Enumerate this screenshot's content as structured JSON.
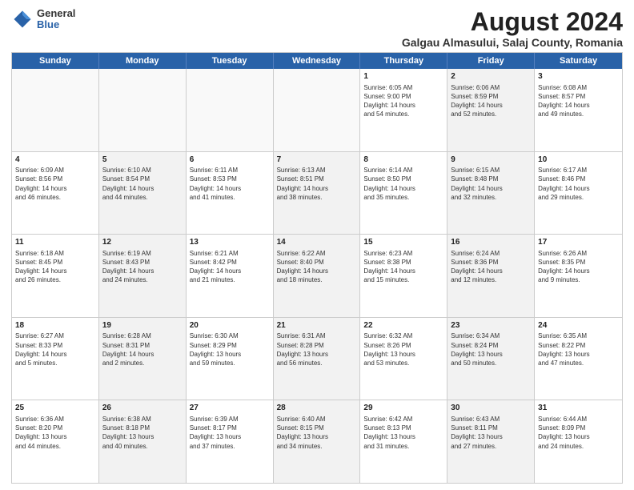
{
  "logo": {
    "general": "General",
    "blue": "Blue"
  },
  "title": "August 2024",
  "subtitle": "Galgau Almasului, Salaj County, Romania",
  "header_days": [
    "Sunday",
    "Monday",
    "Tuesday",
    "Wednesday",
    "Thursday",
    "Friday",
    "Saturday"
  ],
  "rows": [
    [
      {
        "day": "",
        "info": "",
        "shaded": false,
        "empty": true
      },
      {
        "day": "",
        "info": "",
        "shaded": false,
        "empty": true
      },
      {
        "day": "",
        "info": "",
        "shaded": false,
        "empty": true
      },
      {
        "day": "",
        "info": "",
        "shaded": false,
        "empty": true
      },
      {
        "day": "1",
        "info": "Sunrise: 6:05 AM\nSunset: 9:00 PM\nDaylight: 14 hours\nand 54 minutes.",
        "shaded": false,
        "empty": false
      },
      {
        "day": "2",
        "info": "Sunrise: 6:06 AM\nSunset: 8:59 PM\nDaylight: 14 hours\nand 52 minutes.",
        "shaded": true,
        "empty": false
      },
      {
        "day": "3",
        "info": "Sunrise: 6:08 AM\nSunset: 8:57 PM\nDaylight: 14 hours\nand 49 minutes.",
        "shaded": false,
        "empty": false
      }
    ],
    [
      {
        "day": "4",
        "info": "Sunrise: 6:09 AM\nSunset: 8:56 PM\nDaylight: 14 hours\nand 46 minutes.",
        "shaded": false,
        "empty": false
      },
      {
        "day": "5",
        "info": "Sunrise: 6:10 AM\nSunset: 8:54 PM\nDaylight: 14 hours\nand 44 minutes.",
        "shaded": true,
        "empty": false
      },
      {
        "day": "6",
        "info": "Sunrise: 6:11 AM\nSunset: 8:53 PM\nDaylight: 14 hours\nand 41 minutes.",
        "shaded": false,
        "empty": false
      },
      {
        "day": "7",
        "info": "Sunrise: 6:13 AM\nSunset: 8:51 PM\nDaylight: 14 hours\nand 38 minutes.",
        "shaded": true,
        "empty": false
      },
      {
        "day": "8",
        "info": "Sunrise: 6:14 AM\nSunset: 8:50 PM\nDaylight: 14 hours\nand 35 minutes.",
        "shaded": false,
        "empty": false
      },
      {
        "day": "9",
        "info": "Sunrise: 6:15 AM\nSunset: 8:48 PM\nDaylight: 14 hours\nand 32 minutes.",
        "shaded": true,
        "empty": false
      },
      {
        "day": "10",
        "info": "Sunrise: 6:17 AM\nSunset: 8:46 PM\nDaylight: 14 hours\nand 29 minutes.",
        "shaded": false,
        "empty": false
      }
    ],
    [
      {
        "day": "11",
        "info": "Sunrise: 6:18 AM\nSunset: 8:45 PM\nDaylight: 14 hours\nand 26 minutes.",
        "shaded": false,
        "empty": false
      },
      {
        "day": "12",
        "info": "Sunrise: 6:19 AM\nSunset: 8:43 PM\nDaylight: 14 hours\nand 24 minutes.",
        "shaded": true,
        "empty": false
      },
      {
        "day": "13",
        "info": "Sunrise: 6:21 AM\nSunset: 8:42 PM\nDaylight: 14 hours\nand 21 minutes.",
        "shaded": false,
        "empty": false
      },
      {
        "day": "14",
        "info": "Sunrise: 6:22 AM\nSunset: 8:40 PM\nDaylight: 14 hours\nand 18 minutes.",
        "shaded": true,
        "empty": false
      },
      {
        "day": "15",
        "info": "Sunrise: 6:23 AM\nSunset: 8:38 PM\nDaylight: 14 hours\nand 15 minutes.",
        "shaded": false,
        "empty": false
      },
      {
        "day": "16",
        "info": "Sunrise: 6:24 AM\nSunset: 8:36 PM\nDaylight: 14 hours\nand 12 minutes.",
        "shaded": true,
        "empty": false
      },
      {
        "day": "17",
        "info": "Sunrise: 6:26 AM\nSunset: 8:35 PM\nDaylight: 14 hours\nand 9 minutes.",
        "shaded": false,
        "empty": false
      }
    ],
    [
      {
        "day": "18",
        "info": "Sunrise: 6:27 AM\nSunset: 8:33 PM\nDaylight: 14 hours\nand 5 minutes.",
        "shaded": false,
        "empty": false
      },
      {
        "day": "19",
        "info": "Sunrise: 6:28 AM\nSunset: 8:31 PM\nDaylight: 14 hours\nand 2 minutes.",
        "shaded": true,
        "empty": false
      },
      {
        "day": "20",
        "info": "Sunrise: 6:30 AM\nSunset: 8:29 PM\nDaylight: 13 hours\nand 59 minutes.",
        "shaded": false,
        "empty": false
      },
      {
        "day": "21",
        "info": "Sunrise: 6:31 AM\nSunset: 8:28 PM\nDaylight: 13 hours\nand 56 minutes.",
        "shaded": true,
        "empty": false
      },
      {
        "day": "22",
        "info": "Sunrise: 6:32 AM\nSunset: 8:26 PM\nDaylight: 13 hours\nand 53 minutes.",
        "shaded": false,
        "empty": false
      },
      {
        "day": "23",
        "info": "Sunrise: 6:34 AM\nSunset: 8:24 PM\nDaylight: 13 hours\nand 50 minutes.",
        "shaded": true,
        "empty": false
      },
      {
        "day": "24",
        "info": "Sunrise: 6:35 AM\nSunset: 8:22 PM\nDaylight: 13 hours\nand 47 minutes.",
        "shaded": false,
        "empty": false
      }
    ],
    [
      {
        "day": "25",
        "info": "Sunrise: 6:36 AM\nSunset: 8:20 PM\nDaylight: 13 hours\nand 44 minutes.",
        "shaded": false,
        "empty": false
      },
      {
        "day": "26",
        "info": "Sunrise: 6:38 AM\nSunset: 8:18 PM\nDaylight: 13 hours\nand 40 minutes.",
        "shaded": true,
        "empty": false
      },
      {
        "day": "27",
        "info": "Sunrise: 6:39 AM\nSunset: 8:17 PM\nDaylight: 13 hours\nand 37 minutes.",
        "shaded": false,
        "empty": false
      },
      {
        "day": "28",
        "info": "Sunrise: 6:40 AM\nSunset: 8:15 PM\nDaylight: 13 hours\nand 34 minutes.",
        "shaded": true,
        "empty": false
      },
      {
        "day": "29",
        "info": "Sunrise: 6:42 AM\nSunset: 8:13 PM\nDaylight: 13 hours\nand 31 minutes.",
        "shaded": false,
        "empty": false
      },
      {
        "day": "30",
        "info": "Sunrise: 6:43 AM\nSunset: 8:11 PM\nDaylight: 13 hours\nand 27 minutes.",
        "shaded": true,
        "empty": false
      },
      {
        "day": "31",
        "info": "Sunrise: 6:44 AM\nSunset: 8:09 PM\nDaylight: 13 hours\nand 24 minutes.",
        "shaded": false,
        "empty": false
      }
    ]
  ]
}
